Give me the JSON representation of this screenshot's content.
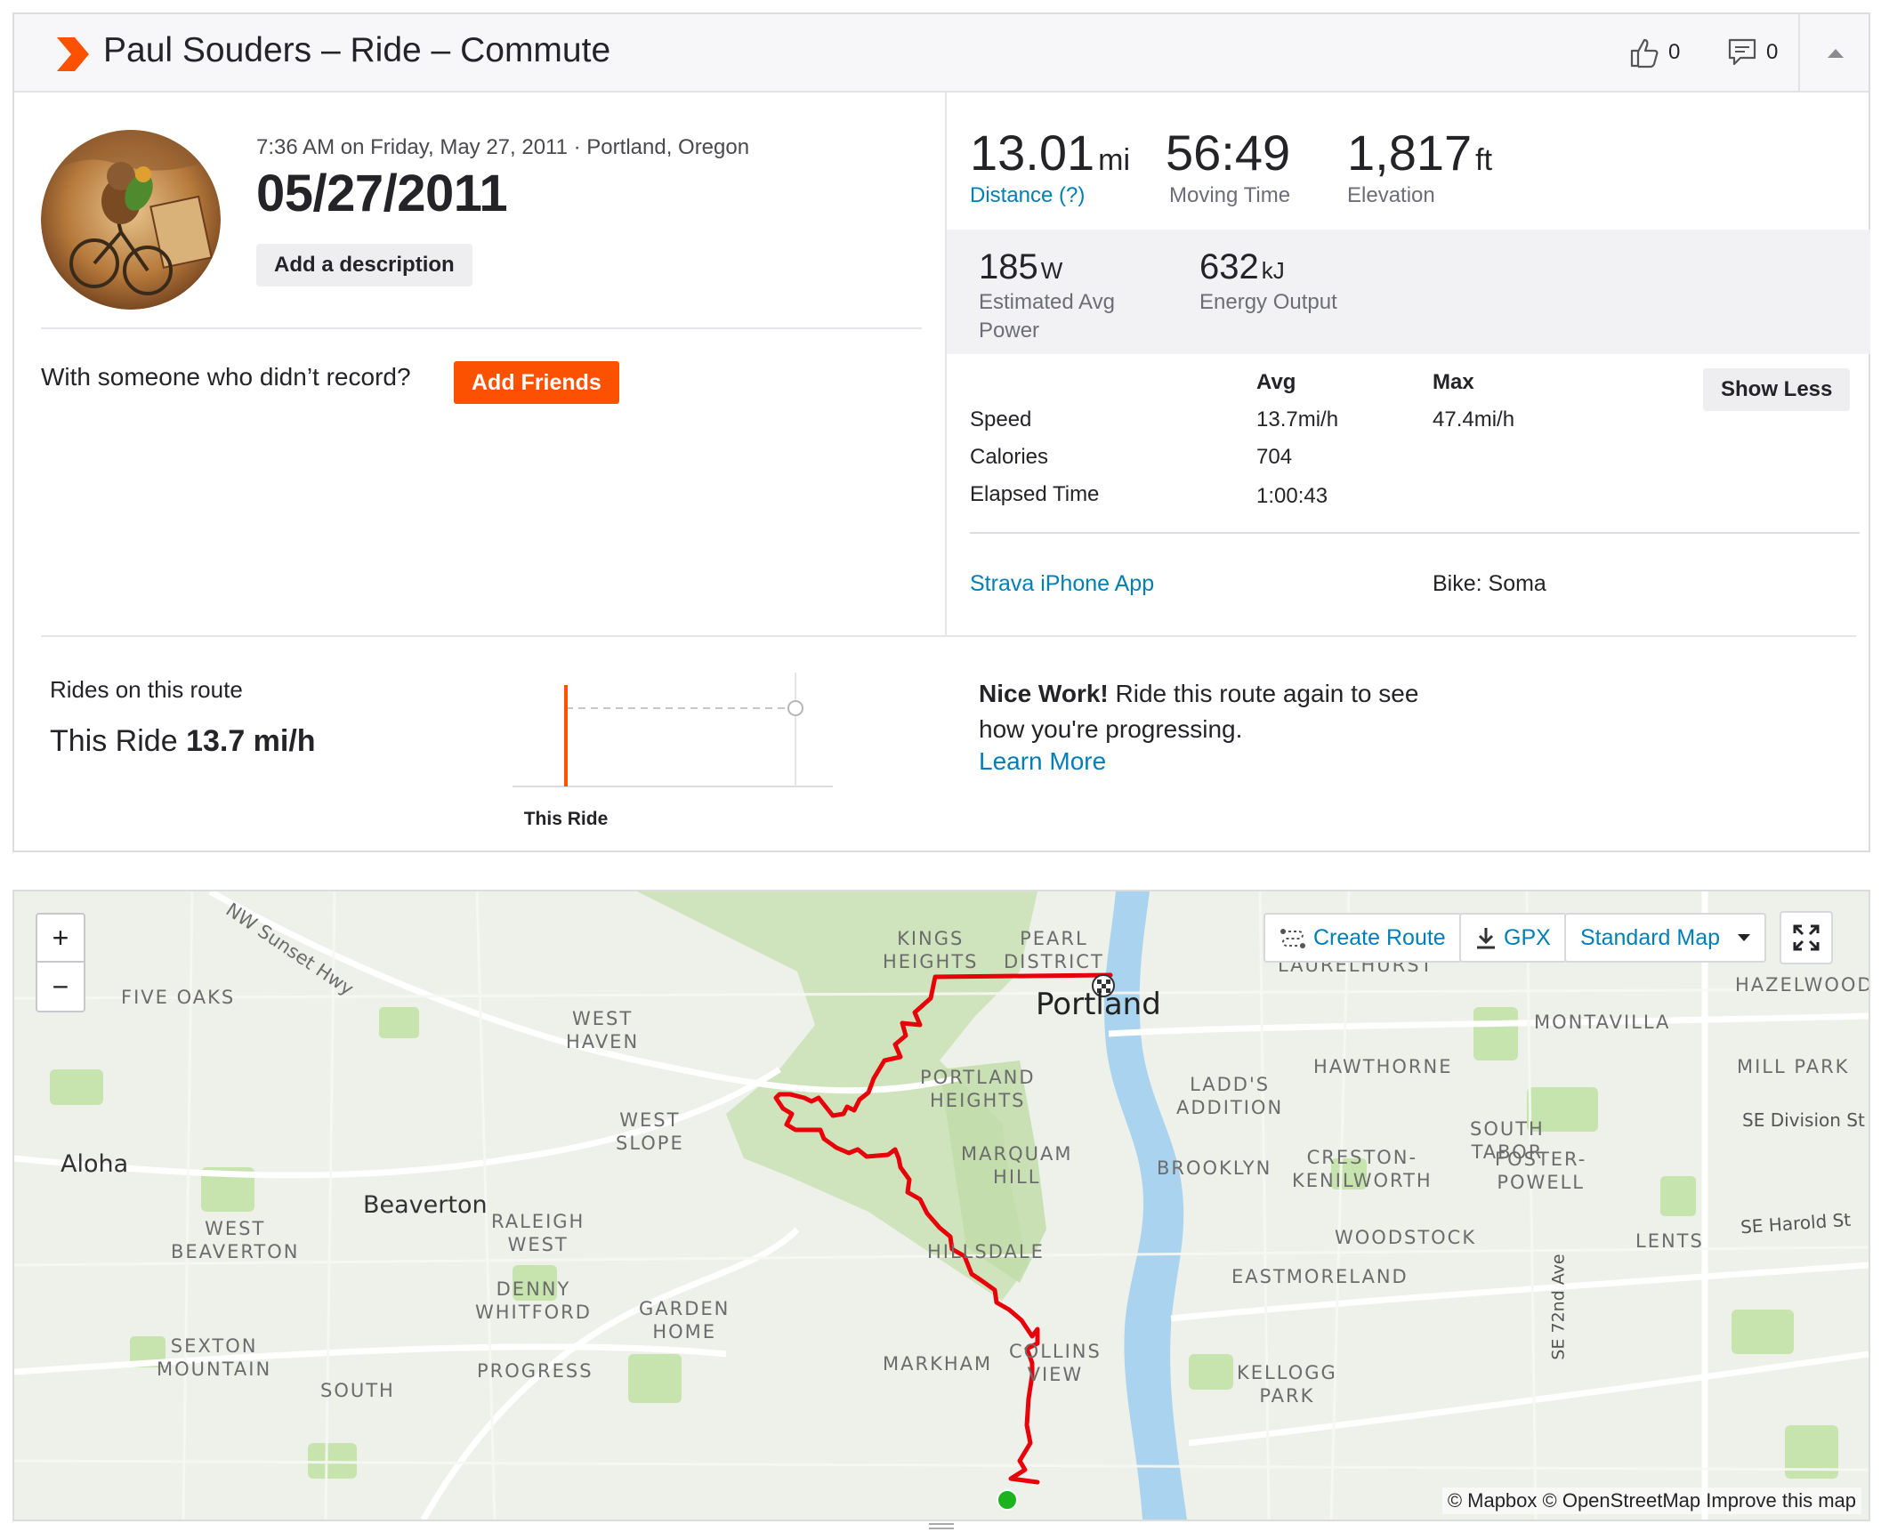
{
  "header": {
    "title": "Paul Souders – Ride – Commute",
    "kudos_count": "0",
    "comment_count": "0"
  },
  "activity": {
    "meta": "7:36 AM on Friday, May 27, 2011 · Portland, Oregon",
    "name": "05/27/2011",
    "add_description": "Add a description",
    "friends_prompt": "With someone who didn’t record?",
    "add_friends": "Add Friends"
  },
  "stats": {
    "distance": {
      "value": "13.01",
      "unit": "mi",
      "label": "Distance (?)"
    },
    "moving_time": {
      "value": "56:49",
      "label": "Moving Time"
    },
    "elevation": {
      "value": "1,817",
      "unit": "ft",
      "label": "Elevation"
    },
    "power": {
      "value": "185",
      "unit": "W",
      "label_line1": "Estimated Avg",
      "label_line2": "Power"
    },
    "energy": {
      "value": "632",
      "unit": "kJ",
      "label": "Energy Output"
    }
  },
  "more_stats": {
    "col_avg": "Avg",
    "col_max": "Max",
    "show_less": "Show Less",
    "rows": [
      {
        "label": "Speed",
        "avg": "13.7mi/h",
        "max": "47.4mi/h"
      },
      {
        "label": "Calories",
        "avg": "704",
        "max": ""
      },
      {
        "label": "Elapsed Time",
        "avg": "1:00:43",
        "max": ""
      }
    ],
    "device": "Strava iPhone App",
    "bike": "Bike: Soma"
  },
  "route": {
    "label": "Rides on this route",
    "speed_prefix": "This Ride",
    "speed_value": "13.7 mi/h",
    "chart_label": "This Ride",
    "nice_bold": "Nice Work!",
    "nice_text": " Ride this route again to see how you're progressing.",
    "learn_more": "Learn More"
  },
  "map": {
    "zoom_in": "+",
    "zoom_out": "−",
    "create_route": "Create Route",
    "gpx": "GPX",
    "map_type": "Standard Map",
    "attribution": "© Mapbox © OpenStreetMap Improve this map",
    "labels": {
      "nw_sunset_hwy": "NW Sunset Hwy",
      "five_oaks": "FIVE OAKS",
      "kings_heights": "KINGS\nHEIGHTS",
      "pearl_district": "PEARL\nDISTRICT",
      "laurelhurst": "LAURELHURST",
      "hazelwood": "HAZELWOOD",
      "portland": "Portland",
      "montavilla": "MONTAVILLA",
      "west_haven": "WEST\nHAVEN",
      "portland_heights": "PORTLAND\nHEIGHTS",
      "ladds_addition": "LADD'S\nADDITION",
      "hawthorne": "HAWTHORNE",
      "mill_park": "MILL PARK",
      "west_slope": "WEST\nSLOPE",
      "marquam_hill": "MARQUAM\nHILL",
      "south_tabor": "SOUTH\nTABOR",
      "se_division": "SE Division St",
      "aloha": "Aloha",
      "brooklyn": "BROOKLYN",
      "creston": "CRESTON-\nKENILWORTH",
      "foster_powell": "FOSTER-\nPOWELL",
      "beaverton": "Beaverton",
      "west_beaverton": "WEST\nBEAVERTON",
      "raleigh_west": "RALEIGH\nWEST",
      "hillsdale": "HILLSDALE",
      "woodstock": "WOODSTOCK",
      "lents": "LENTS",
      "se_harold": "SE Harold St",
      "eastmoreland": "EASTMORELAND",
      "se_72nd": "SE 72nd Ave",
      "denny_whitford": "DENNY\nWHITFORD",
      "garden_home": "GARDEN\nHOME",
      "sexton_mountain": "SEXTON\nMOUNTAIN",
      "markham": "MARKHAM",
      "collins_view": "COLLINS\nVIEW",
      "progress": "PROGRESS",
      "south": "SOUTH",
      "kellogg_park": "KELLOGG\nPARK"
    }
  },
  "colors": {
    "brand": "#fc5200",
    "link": "#007fb6",
    "route_line": "#e8000b",
    "start_marker": "#1db31d",
    "river": "#a9d3ee",
    "park": "#bfe2a4"
  }
}
